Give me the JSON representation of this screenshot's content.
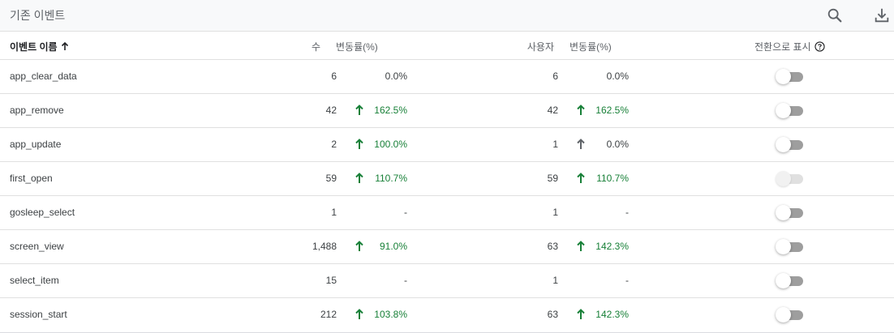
{
  "card": {
    "title": "기존 이벤트"
  },
  "columns": {
    "event_name": "이벤트 이름",
    "count": "수",
    "count_change": "변동률(%)",
    "users": "사용자",
    "users_change": "변동률(%)",
    "mark_conversion": "전환으로 표시"
  },
  "colors": {
    "positive": "#188038",
    "neutral": "#5f6368",
    "toggle_off": "#9e9e9e"
  },
  "rows": [
    {
      "name": "app_clear_data",
      "count": "6",
      "count_trend": "none",
      "count_change": "0.0%",
      "users": "6",
      "users_trend": "none",
      "users_change": "0.0%",
      "conversion": false,
      "conversion_disabled": false
    },
    {
      "name": "app_remove",
      "count": "42",
      "count_trend": "up",
      "count_change": "162.5%",
      "users": "42",
      "users_trend": "up",
      "users_change": "162.5%",
      "conversion": false,
      "conversion_disabled": false
    },
    {
      "name": "app_update",
      "count": "2",
      "count_trend": "up",
      "count_change": "100.0%",
      "users": "1",
      "users_trend": "flat-up",
      "users_change": "0.0%",
      "conversion": false,
      "conversion_disabled": false
    },
    {
      "name": "first_open",
      "count": "59",
      "count_trend": "up",
      "count_change": "110.7%",
      "users": "59",
      "users_trend": "up",
      "users_change": "110.7%",
      "conversion": false,
      "conversion_disabled": true
    },
    {
      "name": "gosleep_select",
      "count": "1",
      "count_trend": "none",
      "count_change": "-",
      "users": "1",
      "users_trend": "none",
      "users_change": "-",
      "conversion": false,
      "conversion_disabled": false
    },
    {
      "name": "screen_view",
      "count": "1,488",
      "count_trend": "up",
      "count_change": "91.0%",
      "users": "63",
      "users_trend": "up",
      "users_change": "142.3%",
      "conversion": false,
      "conversion_disabled": false
    },
    {
      "name": "select_item",
      "count": "15",
      "count_trend": "none",
      "count_change": "-",
      "users": "1",
      "users_trend": "none",
      "users_change": "-",
      "conversion": false,
      "conversion_disabled": false
    },
    {
      "name": "session_start",
      "count": "212",
      "count_trend": "up",
      "count_change": "103.8%",
      "users": "63",
      "users_trend": "up",
      "users_change": "142.3%",
      "conversion": false,
      "conversion_disabled": false
    }
  ],
  "icons": {
    "search": "search-icon",
    "download": "download-icon",
    "sort": "arrow-up-icon",
    "help": "help-circle-icon",
    "trend_up": "arrow-up-icon"
  }
}
